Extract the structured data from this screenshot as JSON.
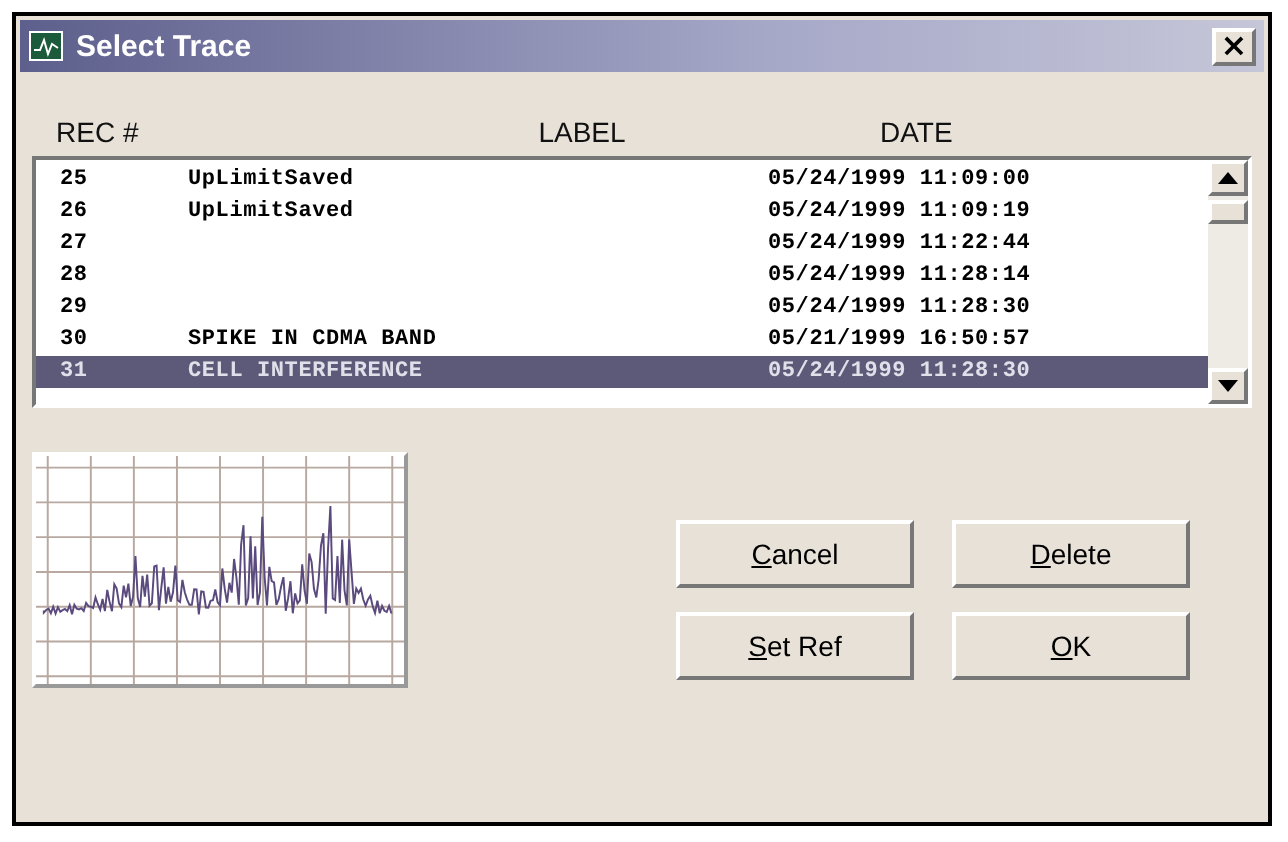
{
  "window": {
    "title": "Select Trace",
    "close": "×"
  },
  "columns": [
    "REC #",
    "LABEL",
    "DATE"
  ],
  "rows": [
    {
      "rec": "25",
      "label": "UpLimitSaved",
      "date": "05/24/1999 11:09:00",
      "selected": false
    },
    {
      "rec": "26",
      "label": "UpLimitSaved",
      "date": "05/24/1999 11:09:19",
      "selected": false
    },
    {
      "rec": "27",
      "date": "05/24/1999 11:22:44",
      "selected": false
    },
    {
      "rec": "28",
      "date": "05/24/1999 11:28:14",
      "selected": false
    },
    {
      "rec": "29",
      "date": "05/24/1999 11:28:30",
      "selected": false
    },
    {
      "rec": "30",
      "label": "SPIKE IN CDMA BAND",
      "date": "05/21/1999 16:50:57",
      "selected": false
    },
    {
      "rec": "31",
      "label": "CELL INTERFERENCE",
      "date": "05/24/1999 11:28:30",
      "selected": true
    }
  ],
  "buttons": [
    "Cancel",
    "Delete",
    "Set Ref",
    "OK"
  ]
}
